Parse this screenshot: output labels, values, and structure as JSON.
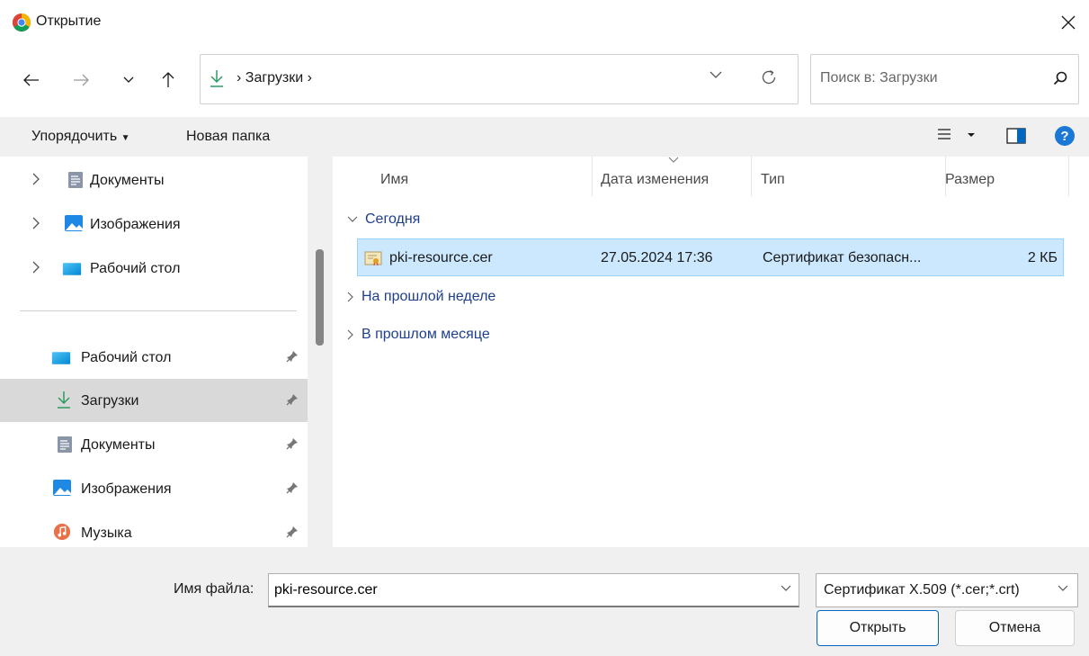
{
  "window": {
    "title": "Открытие",
    "app_icon": "chrome-icon"
  },
  "nav": {
    "back_icon": "arrow-left-icon",
    "forward_icon": "arrow-right-icon",
    "recent_icon": "chevron-down-icon",
    "up_icon": "arrow-up-icon",
    "breadcrumb": "Загрузки",
    "refresh_icon": "refresh-icon"
  },
  "search": {
    "placeholder": "Поиск в: Загрузки"
  },
  "toolbar": {
    "organize_label": "Упорядочить",
    "new_folder_label": "Новая папка"
  },
  "sidebar": {
    "tree": [
      {
        "label": "Документы",
        "icon": "documents-icon"
      },
      {
        "label": "Изображения",
        "icon": "pictures-icon"
      },
      {
        "label": "Рабочий стол",
        "icon": "desktop-icon"
      }
    ],
    "quick": [
      {
        "label": "Рабочий стол",
        "icon": "desktop-icon",
        "selected": false
      },
      {
        "label": "Загрузки",
        "icon": "download-icon",
        "selected": true
      },
      {
        "label": "Документы",
        "icon": "documents-icon",
        "selected": false
      },
      {
        "label": "Изображения",
        "icon": "pictures-icon",
        "selected": false
      },
      {
        "label": "Музыка",
        "icon": "music-icon",
        "selected": false
      }
    ]
  },
  "columns": {
    "name": "Имя",
    "date": "Дата изменения",
    "type": "Тип",
    "size": "Размер"
  },
  "groups": {
    "today": "Сегодня",
    "last_week": "На прошлой неделе",
    "last_month": "В прошлом месяце"
  },
  "file": {
    "name": "pki-resource.cer",
    "date": "27.05.2024 17:36",
    "type": "Сертификат безопасн...",
    "size": "2 КБ"
  },
  "footer": {
    "filename_label": "Имя файла:",
    "filename_value": "pki-resource.cer",
    "filetype_value": "Сертификат X.509 (*.cer;*.crt)",
    "open_label": "Открыть",
    "cancel_label": "Отмена"
  },
  "colors": {
    "selected_row": "#cce8ff",
    "accent": "#0067c0",
    "group_text": "#1e3e8e"
  }
}
